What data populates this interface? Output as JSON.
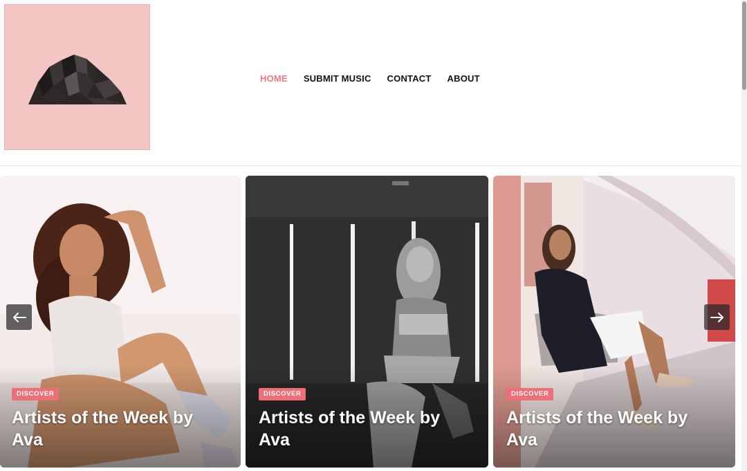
{
  "nav": {
    "items": [
      {
        "label": "HOME",
        "active": true
      },
      {
        "label": "SUBMIT MUSIC",
        "active": false
      },
      {
        "label": "CONTACT",
        "active": false
      },
      {
        "label": "ABOUT",
        "active": false
      }
    ]
  },
  "slider": {
    "cards": [
      {
        "category": "DISCOVER",
        "title": "Artists of the Week by Ava"
      },
      {
        "category": "DISCOVER",
        "title": "Artists of the Week by Ava"
      },
      {
        "category": "DISCOVER",
        "title": "Artists of the Week by Ava"
      }
    ],
    "prev_icon": "arrow-left-icon",
    "next_icon": "arrow-right-icon"
  },
  "colors": {
    "accent": "#ec7a80",
    "badge": "#ef6f78",
    "logo_bg": "#f3c5c3"
  }
}
